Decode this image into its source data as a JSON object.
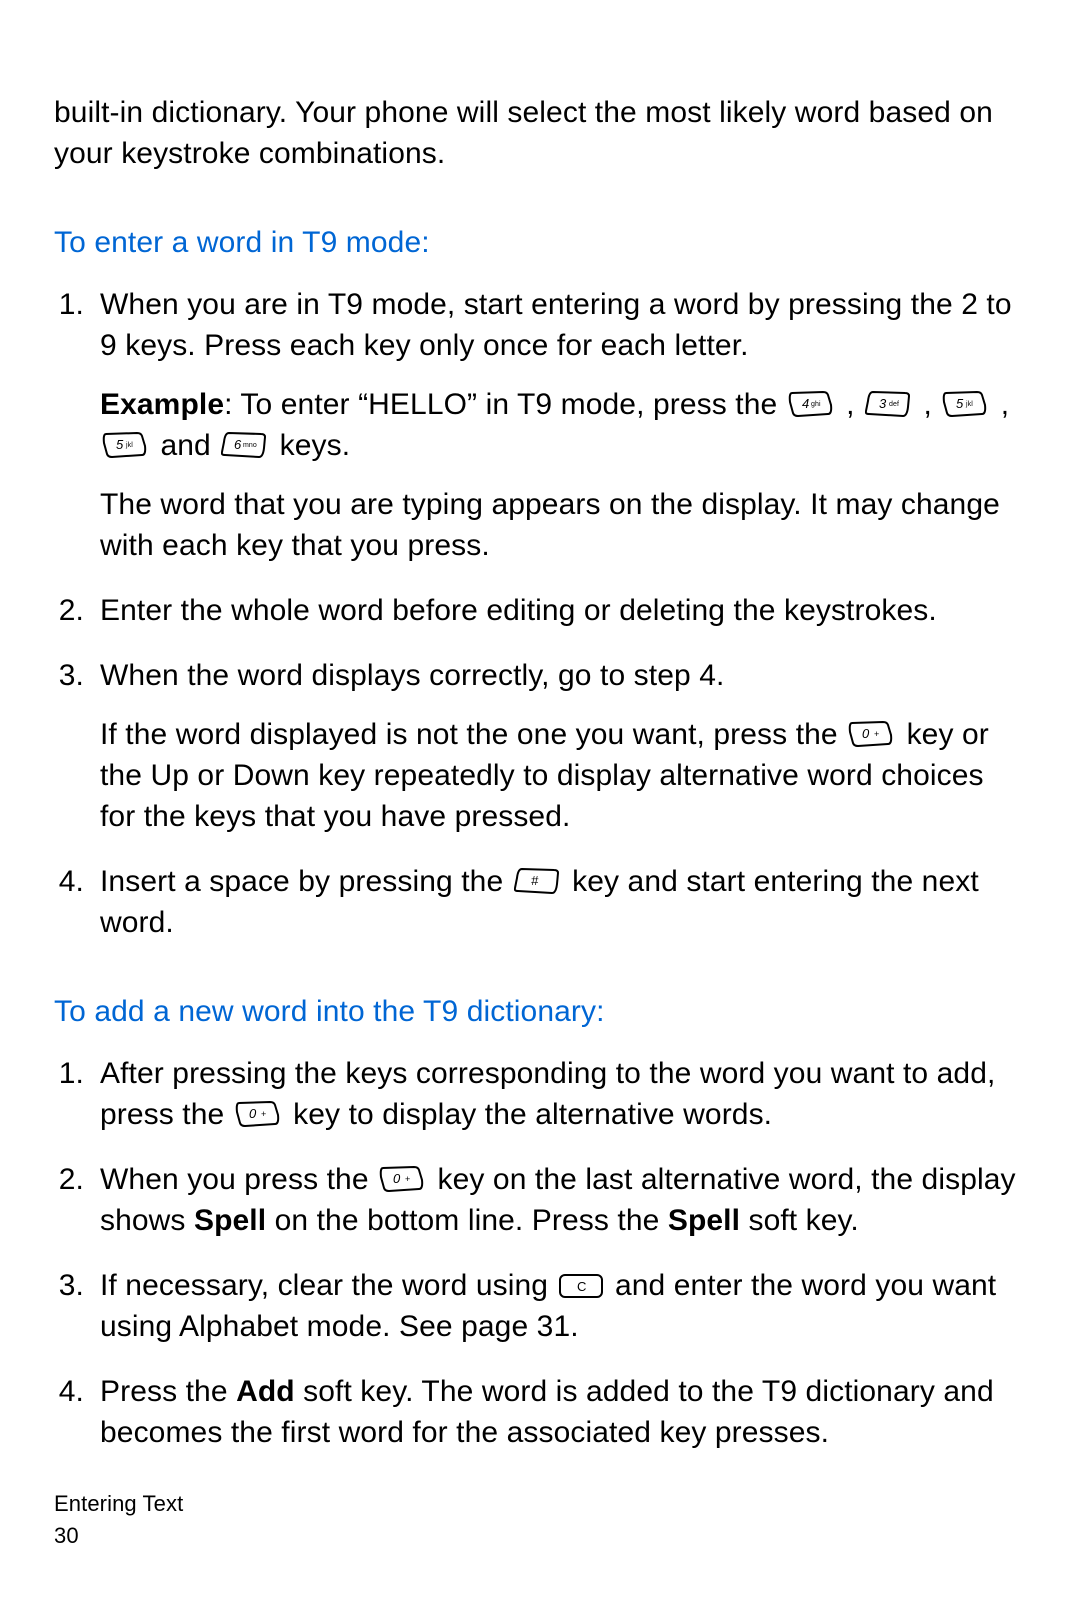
{
  "intro": "built-in dictionary. Your phone will select the most likely word based on your keystroke combinations.",
  "section1": {
    "heading": "To enter a word in T9 mode:",
    "items": [
      {
        "num": "1.",
        "text": "When you are in T9 mode, start entering a word by pressing the 2 to 9 keys. Press each key only once for each letter.",
        "example_lead": "Example",
        "example_a": ": To enter “HELLO” in T9 mode, press the ",
        "example_b": " and ",
        "example_c": " keys.",
        "aftermath": "The word that you are typing appears on the display. It may change with each key that you press."
      },
      {
        "num": "2.",
        "text": "Enter the whole word before editing or deleting the keystrokes."
      },
      {
        "num": "3.",
        "text": "When the word displays correctly, go to step 4.",
        "cont_a": "If the word displayed is not the one you want, press the ",
        "cont_b": " key or the Up or Down key repeatedly to display alternative word choices for the keys that you have pressed."
      },
      {
        "num": "4.",
        "text_a": "Insert a space by pressing the ",
        "text_b": " key and start entering the next word."
      }
    ]
  },
  "section2": {
    "heading": "To add a new word into the T9 dictionary:",
    "items": [
      {
        "num": "1.",
        "text_a": "After pressing the keys corresponding to the word you want to add, press the ",
        "text_b": " key to display the alternative words."
      },
      {
        "num": "2.",
        "text_a": "When you press the ",
        "text_b": " key on the last alternative word, the display shows ",
        "spell": "Spell",
        "text_c": " on the bottom line. Press the ",
        "text_d": " soft key."
      },
      {
        "num": "3.",
        "text_a": "If necessary, clear the word using ",
        "text_b": " and enter the word you want using Alphabet mode. See page 31."
      },
      {
        "num": "4.",
        "text_a": "Press the ",
        "add": "Add",
        "text_b": " soft key. The word is added to the T9 dictionary and becomes the first word for the associated key presses."
      }
    ]
  },
  "keys": {
    "k4": "4 ghi",
    "k3": "3 def",
    "k5": "5 jkl",
    "k6": "6 mno",
    "k0": "0 +",
    "khash": "#",
    "kc": "C"
  },
  "footer": {
    "section": "Entering Text",
    "page": "30"
  }
}
